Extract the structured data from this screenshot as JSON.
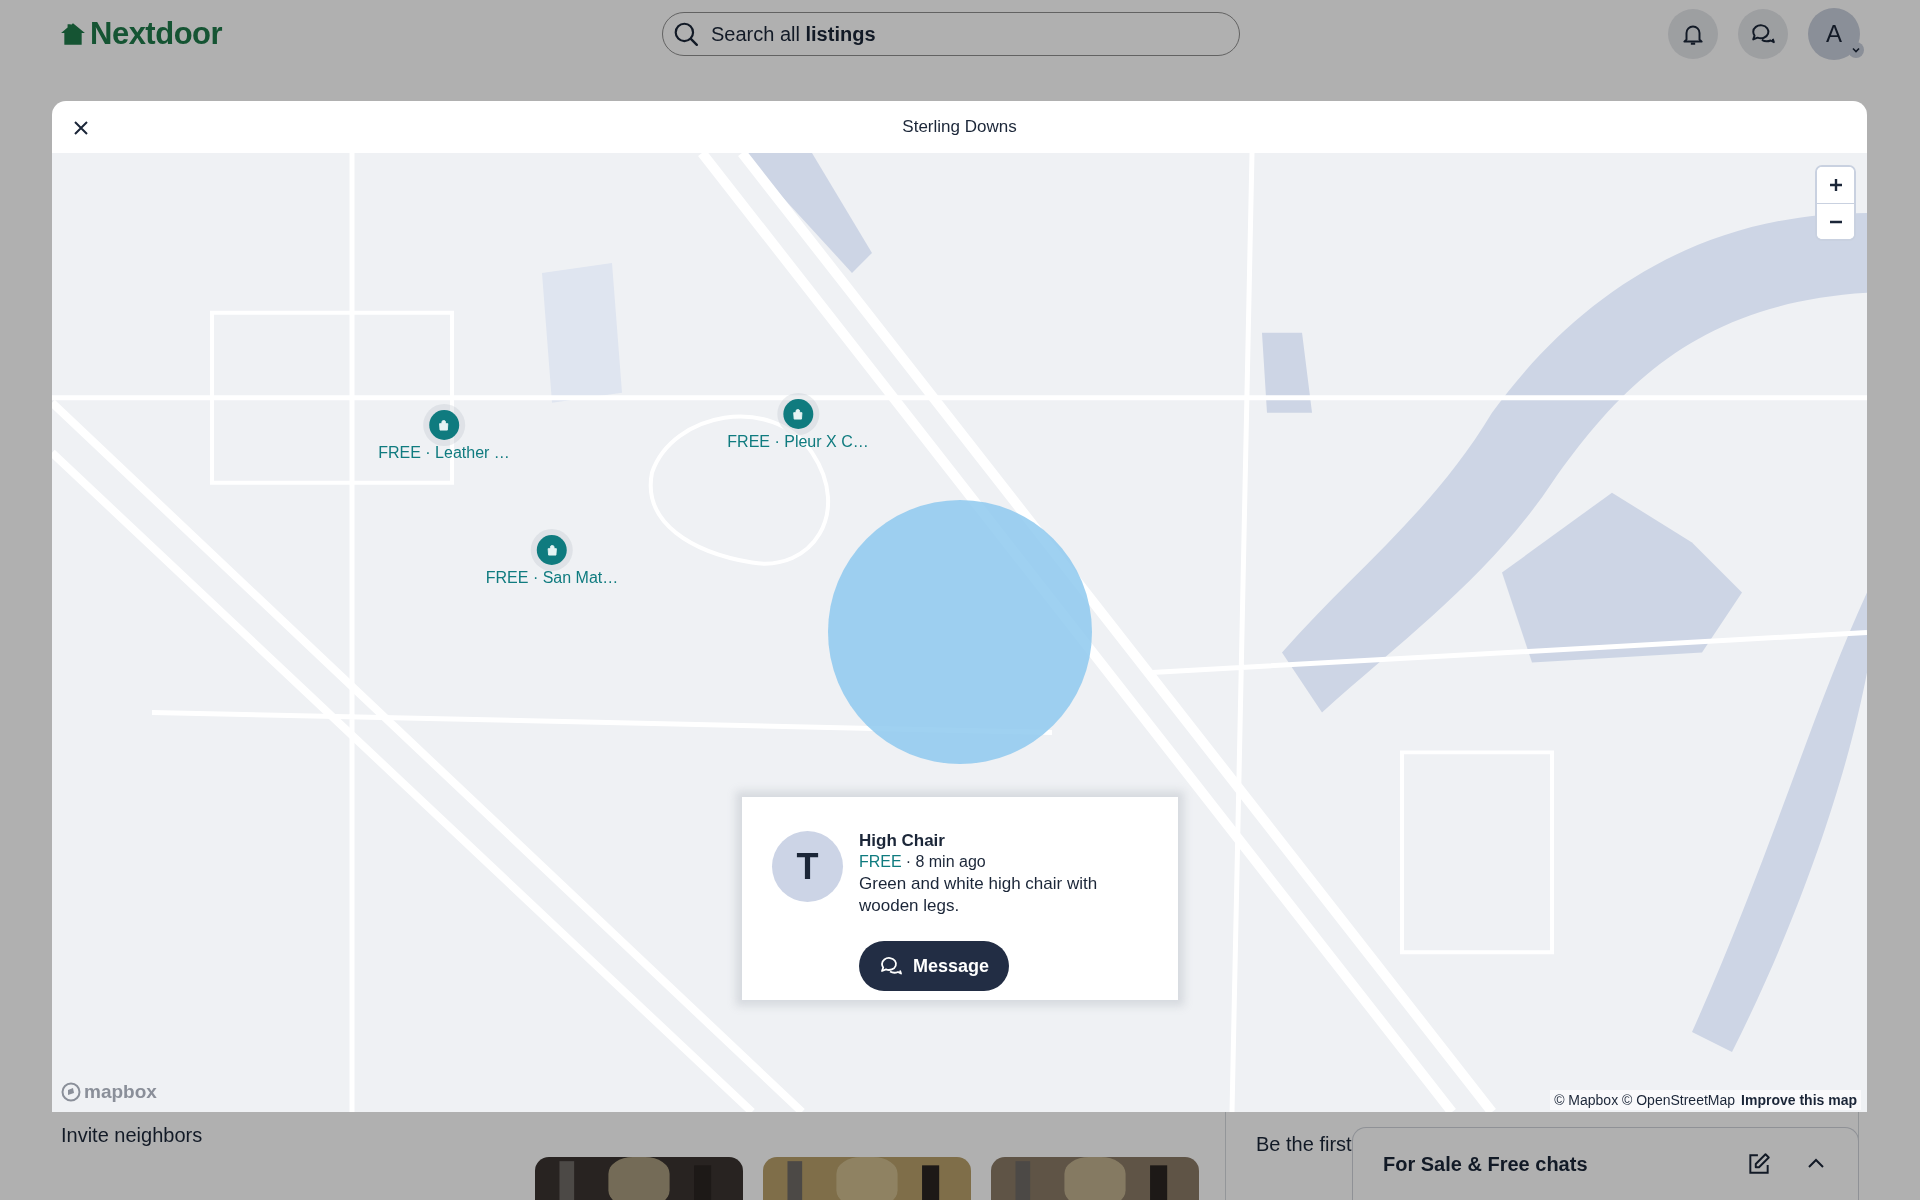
{
  "header": {
    "logo": "Nextdoor",
    "search": "Search all **listings**",
    "avatar": "A"
  },
  "page": {
    "invite": "Invite neighbors",
    "comments_hint": "Be the first",
    "chat_bar": "For Sale & Free chats"
  },
  "modal": {
    "title": "Sterling Downs",
    "markers": [
      {
        "label": "FREE · Leather …"
      },
      {
        "label": "FREE · Pleur X C…"
      },
      {
        "label": "FREE · San Mat…"
      }
    ],
    "listing": {
      "avatar": "T",
      "title": "High Chair",
      "price": "FREE",
      "meta": "· 8 min ago",
      "description": "Green and white high chair with wooden legs.",
      "button": "Message"
    },
    "map_logo": "mapbox",
    "attribution": "© Mapbox © OpenStreetMap",
    "improve_link": "Improve this map"
  }
}
